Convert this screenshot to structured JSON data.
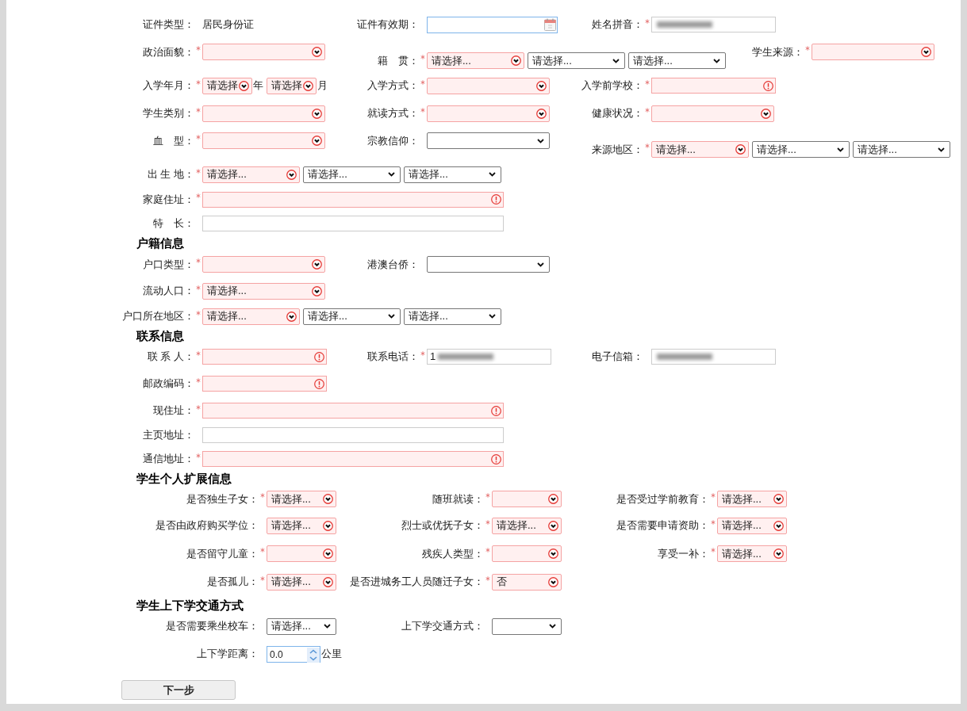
{
  "sections": [
    {
      "rows": [
        {
          "cells": [
            {
              "label": "证件类型：",
              "required": false,
              "controls": [
                {
                  "kind": "static",
                  "value": "居民身份证"
                }
              ]
            },
            {
              "label": "证件有效期：",
              "required": false,
              "controls": [
                {
                  "kind": "date"
                }
              ]
            },
            {
              "label": "姓名拼音：",
              "required": true,
              "controls": [
                {
                  "kind": "input",
                  "invalid": false,
                  "redacted": true
                }
              ]
            }
          ]
        },
        {
          "cells": [
            {
              "label": "政治面貌：",
              "required": true,
              "controls": [
                {
                  "kind": "select",
                  "invalid": true
                }
              ]
            },
            {
              "label": "籍　贯：",
              "required": true,
              "controls": [
                {
                  "kind": "select-region",
                  "invalid": true,
                  "value": "请选择..."
                },
                {
                  "kind": "select-region",
                  "invalid": false,
                  "value": "请选择..."
                },
                {
                  "kind": "select-region",
                  "invalid": false,
                  "value": "请选择..."
                }
              ]
            },
            {
              "label": "学生来源：",
              "required": true,
              "controls": [
                {
                  "kind": "select",
                  "invalid": true
                }
              ]
            }
          ]
        },
        {
          "cells": [
            {
              "label": "入学年月：",
              "required": true,
              "controls": [
                {
                  "kind": "select-narrow",
                  "invalid": true,
                  "value": "请选择",
                  "suffix": "年"
                },
                {
                  "kind": "select-narrow",
                  "invalid": true,
                  "value": "请选择",
                  "suffix": "月"
                }
              ]
            },
            {
              "label": "入学方式：",
              "required": true,
              "controls": [
                {
                  "kind": "select",
                  "invalid": true
                }
              ]
            },
            {
              "label": "入学前学校：",
              "required": true,
              "controls": [
                {
                  "kind": "input",
                  "invalid": true
                }
              ]
            }
          ]
        },
        {
          "cells": [
            {
              "label": "学生类别：",
              "required": true,
              "controls": [
                {
                  "kind": "select",
                  "invalid": true
                }
              ]
            },
            {
              "label": "就读方式：",
              "required": true,
              "controls": [
                {
                  "kind": "select",
                  "invalid": true
                }
              ]
            },
            {
              "label": "健康状况：",
              "required": true,
              "controls": [
                {
                  "kind": "select",
                  "invalid": true
                }
              ]
            }
          ]
        },
        {
          "cells": [
            {
              "label": "血　型：",
              "required": true,
              "controls": [
                {
                  "kind": "select",
                  "invalid": true
                }
              ]
            },
            {
              "label": "宗教信仰：",
              "required": false,
              "controls": [
                {
                  "kind": "select",
                  "invalid": false
                }
              ]
            },
            {
              "label": "来源地区：",
              "required": true,
              "controls": [
                {
                  "kind": "select-region",
                  "invalid": true,
                  "value": "请选择..."
                },
                {
                  "kind": "select-region",
                  "invalid": false,
                  "value": "请选择..."
                },
                {
                  "kind": "select-region",
                  "invalid": false,
                  "value": "请选择..."
                }
              ]
            }
          ]
        },
        {
          "cells": [
            {
              "label": "出 生 地：",
              "required": true,
              "controls": [
                {
                  "kind": "select-region",
                  "invalid": true,
                  "value": "请选择..."
                },
                {
                  "kind": "select-region",
                  "invalid": false,
                  "value": "请选择..."
                },
                {
                  "kind": "select-region",
                  "invalid": false,
                  "value": "请选择..."
                }
              ]
            }
          ]
        },
        {
          "cells": [
            {
              "label": "家庭住址：",
              "required": true,
              "controls": [
                {
                  "kind": "input-long",
                  "invalid": true
                }
              ]
            }
          ]
        },
        {
          "cells": [
            {
              "label": "特　长：",
              "required": false,
              "controls": [
                {
                  "kind": "input-long",
                  "invalid": false
                }
              ]
            }
          ]
        }
      ]
    },
    {
      "heading": "户籍信息",
      "rows": [
        {
          "cells": [
            {
              "label": "户口类型：",
              "required": true,
              "controls": [
                {
                  "kind": "select",
                  "invalid": true
                }
              ]
            },
            {
              "label": "港澳台侨：",
              "required": false,
              "controls": [
                {
                  "kind": "select",
                  "invalid": false
                }
              ]
            }
          ]
        },
        {
          "cells": [
            {
              "label": "流动人口：",
              "required": true,
              "controls": [
                {
                  "kind": "select",
                  "invalid": true,
                  "value": "请选择..."
                }
              ]
            }
          ]
        },
        {
          "cells": [
            {
              "label": "户口所在地区：",
              "required": true,
              "controls": [
                {
                  "kind": "select-region",
                  "invalid": true,
                  "value": "请选择..."
                },
                {
                  "kind": "select-region",
                  "invalid": false,
                  "value": "请选择..."
                },
                {
                  "kind": "select-region",
                  "invalid": false,
                  "value": "请选择..."
                }
              ]
            }
          ]
        }
      ]
    },
    {
      "heading": "联系信息",
      "rows": [
        {
          "cells": [
            {
              "label": "联 系 人：",
              "required": true,
              "controls": [
                {
                  "kind": "input",
                  "invalid": true
                }
              ]
            },
            {
              "label": "联系电话：",
              "required": true,
              "controls": [
                {
                  "kind": "input",
                  "invalid": false,
                  "value": "1",
                  "redacted": true
                }
              ]
            },
            {
              "label": "电子信箱：",
              "required": false,
              "controls": [
                {
                  "kind": "input",
                  "invalid": false,
                  "redacted": true
                }
              ]
            }
          ]
        },
        {
          "cells": [
            {
              "label": "邮政编码：",
              "required": true,
              "controls": [
                {
                  "kind": "input",
                  "invalid": true
                }
              ]
            }
          ]
        },
        {
          "cells": [
            {
              "label": "现住址：",
              "required": true,
              "controls": [
                {
                  "kind": "input-long",
                  "invalid": true
                }
              ]
            }
          ]
        },
        {
          "cells": [
            {
              "label": "主页地址：",
              "required": false,
              "controls": [
                {
                  "kind": "input-long",
                  "invalid": false
                }
              ]
            }
          ]
        },
        {
          "cells": [
            {
              "label": "通信地址：",
              "required": true,
              "controls": [
                {
                  "kind": "input-long",
                  "invalid": true
                }
              ]
            }
          ]
        }
      ]
    },
    {
      "heading": "学生个人扩展信息",
      "rows": [
        {
          "cells": [
            {
              "label": "是否独生子女：",
              "required": true,
              "controls": [
                {
                  "kind": "select-short",
                  "invalid": true,
                  "value": "请选择..."
                }
              ]
            },
            {
              "label": "随班就读：",
              "required": true,
              "controls": [
                {
                  "kind": "select-short",
                  "invalid": true
                }
              ]
            },
            {
              "label": "是否受过学前教育：",
              "required": true,
              "controls": [
                {
                  "kind": "select-short",
                  "invalid": true,
                  "value": "请选择..."
                }
              ]
            }
          ]
        },
        {
          "cells": [
            {
              "label": "是否由政府购买学位：",
              "required": false,
              "controls": [
                {
                  "kind": "select-short",
                  "invalid": true,
                  "value": "请选择..."
                }
              ]
            },
            {
              "label": "烈士或优抚子女：",
              "required": true,
              "controls": [
                {
                  "kind": "select-short",
                  "invalid": true,
                  "value": "请选择..."
                }
              ]
            },
            {
              "label": "是否需要申请资助：",
              "required": true,
              "controls": [
                {
                  "kind": "select-short",
                  "invalid": true,
                  "value": "请选择..."
                }
              ]
            }
          ]
        },
        {
          "cells": [
            {
              "label": "是否留守儿童：",
              "required": true,
              "controls": [
                {
                  "kind": "select-short",
                  "invalid": true
                }
              ]
            },
            {
              "label": "残疾人类型：",
              "required": true,
              "controls": [
                {
                  "kind": "select-short",
                  "invalid": true
                }
              ]
            },
            {
              "label": "享受一补：",
              "required": true,
              "controls": [
                {
                  "kind": "select-short",
                  "invalid": true,
                  "value": "请选择..."
                }
              ]
            }
          ]
        },
        {
          "cells": [
            {
              "label": "是否孤儿：",
              "required": true,
              "controls": [
                {
                  "kind": "select-short",
                  "invalid": true,
                  "value": "请选择..."
                }
              ]
            },
            {
              "label": "是否进城务工人员随迁子女：",
              "required": true,
              "controls": [
                {
                  "kind": "select-short",
                  "invalid": true,
                  "value": "否"
                }
              ]
            }
          ]
        }
      ]
    },
    {
      "heading": "学生上下学交通方式",
      "rows": [
        {
          "cells": [
            {
              "label": "是否需要乘坐校车：",
              "required": false,
              "controls": [
                {
                  "kind": "select-short",
                  "invalid": false,
                  "value": "请选择..."
                }
              ]
            },
            {
              "label": "上下学交通方式：",
              "required": false,
              "controls": [
                {
                  "kind": "select-short",
                  "invalid": false
                }
              ]
            }
          ]
        },
        {
          "cells": [
            {
              "label": "上下学距离：",
              "required": false,
              "controls": [
                {
                  "kind": "number",
                  "value": "0.0",
                  "suffix": "公里"
                }
              ]
            }
          ]
        }
      ]
    }
  ],
  "next_button": "下一步"
}
